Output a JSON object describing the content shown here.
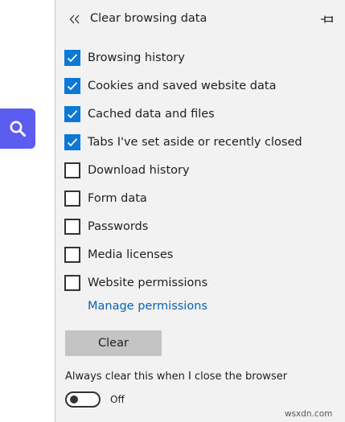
{
  "search": {
    "icon": "search-icon",
    "color": "#5b5df0"
  },
  "panel": {
    "title": "Clear browsing data",
    "back_icon": "double-chevron-left-icon",
    "pin_icon": "pin-icon"
  },
  "options": [
    {
      "label": "Browsing history",
      "checked": true
    },
    {
      "label": "Cookies and saved website data",
      "checked": true
    },
    {
      "label": "Cached data and files",
      "checked": true
    },
    {
      "label": "Tabs I've set aside or recently closed",
      "checked": true
    },
    {
      "label": "Download history",
      "checked": false
    },
    {
      "label": "Form data",
      "checked": false
    },
    {
      "label": "Passwords",
      "checked": false
    },
    {
      "label": "Media licenses",
      "checked": false
    },
    {
      "label": "Website permissions",
      "checked": false
    }
  ],
  "manage_permissions_link": "Manage permissions",
  "clear_button": "Clear",
  "always_clear": {
    "label": "Always clear this when I close the browser",
    "state_text": "Off",
    "enabled": false
  },
  "colors": {
    "accent": "#0a78d4",
    "link": "#0a63b8",
    "panel_bg": "#f2f2f2",
    "button_bg": "#c4c4c4"
  },
  "watermark": "wsxdn.com"
}
